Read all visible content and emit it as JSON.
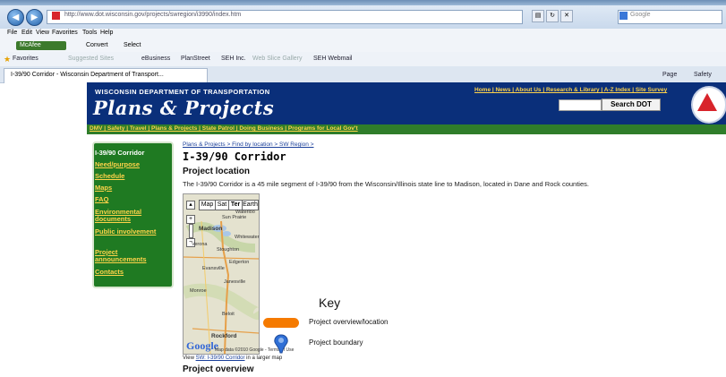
{
  "browser": {
    "url": "http://www.dot.wisconsin.gov/projects/swregion/i3990/index.htm",
    "search_placeholder": "Google",
    "menu": [
      "File",
      "Edit",
      "View",
      "Favorites",
      "Tools",
      "Help"
    ],
    "toolbar": {
      "mcafee": "McAfee",
      "convert": "Convert",
      "select": "Select"
    },
    "favorites": [
      "Favorites",
      "Suggested Sites",
      "eBusiness",
      "PlanStreet",
      "SEH Inc.",
      "Web Slice Gallery",
      "SEH Webmail"
    ],
    "tab_title": "I-39/90 Corridor - Wisconsin Department of Transport...",
    "right_commands": [
      "Page",
      "Safety"
    ]
  },
  "header": {
    "department": "WISCONSIN DEPARTMENT OF TRANSPORTATION",
    "site_title": "Plans & Projects",
    "top_links": "Home | News | About Us | Research & Library | A-Z Index | Site Survey",
    "search_button": "Search DOT"
  },
  "topnav": "DMV | Safety | Travel | Plans & Projects | State Patrol | Doing Business | Programs for Local Gov't",
  "sidebar": {
    "items": [
      {
        "label": "I-39/90 Corridor"
      },
      {
        "label": "Need/purpose"
      },
      {
        "label": "Schedule"
      },
      {
        "label": "Maps"
      },
      {
        "label": "FAQ"
      },
      {
        "label": "Environmental documents"
      },
      {
        "label": "Public involvement"
      },
      {
        "label": "Project announcements"
      },
      {
        "label": "Contacts"
      }
    ]
  },
  "main": {
    "breadcrumb": "Plans & Projects > Find by location > SW Region >",
    "title": "I-39/90 Corridor",
    "section1": "Project location",
    "description": "The I-39/90 Corridor is a 45 mile segment of I-39/90 from the Wisconsin/Illinois state line to Madison, located in Dane and Rock counties.",
    "section2": "Project overview",
    "view_prefix": "View",
    "view_link": "SW: I-39/90 Corridor",
    "view_suffix": "in a larger map"
  },
  "map": {
    "buttons": [
      "Map",
      "Sat",
      "Ter",
      "Earth"
    ],
    "places": [
      "Madison",
      "Sun Prairie",
      "Waterloo",
      "Verona",
      "Stoughton",
      "Janesville",
      "Beloit",
      "Rockford",
      "Monroe",
      "Edgerton",
      "Evansville",
      "Whitewater"
    ],
    "logo": "Google",
    "credit": "Map data ©2010 Google - Terms of Use"
  },
  "key": {
    "title": "Key",
    "item1": "Project overview/location",
    "item2": "Project boundary",
    "swatch_color": "#f57a00"
  }
}
